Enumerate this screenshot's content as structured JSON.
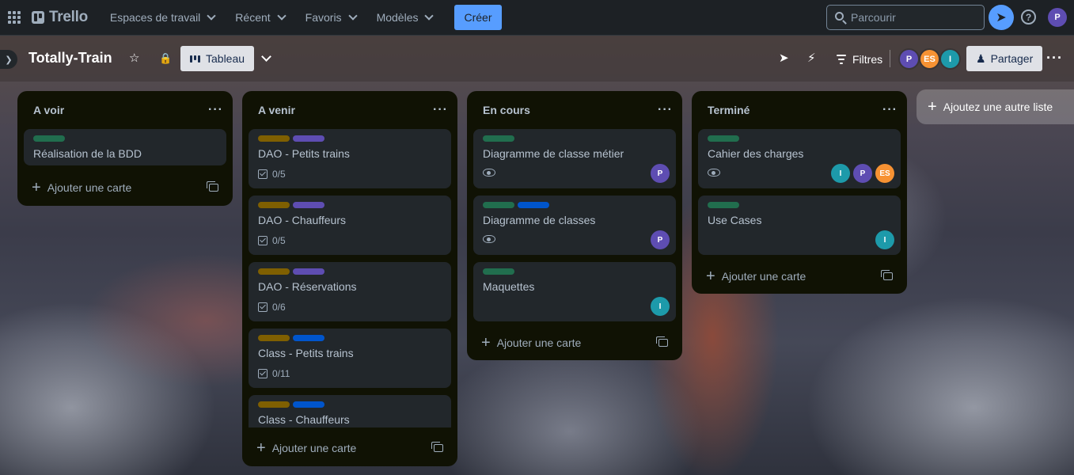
{
  "topnav": {
    "logo": "Trello",
    "menus": [
      "Espaces de travail",
      "Récent",
      "Favoris",
      "Modèles"
    ],
    "create_label": "Créer",
    "search_placeholder": "Parcourir",
    "user_initial": "P"
  },
  "board": {
    "title": "Totally-Train",
    "view_label": "Tableau",
    "filters_label": "Filtres",
    "members": [
      {
        "initials": "P",
        "color": "#5e4db2"
      },
      {
        "initials": "ES",
        "color": "#f79233"
      },
      {
        "initials": "I",
        "color": "#1d9aaa"
      }
    ],
    "share_label": "Partager",
    "add_list_label": "Ajoutez une autre liste"
  },
  "colors": {
    "green": "#216e4e",
    "yellow": "#7f5f01",
    "purple": "#5e4db2",
    "blue": "#0055cc",
    "primary": "#579dff"
  },
  "lists": [
    {
      "title": "A voir",
      "add_card_label": "Ajouter une carte",
      "cards": [
        {
          "title": "Réalisation de la BDD",
          "labels": [
            "green"
          ]
        }
      ]
    },
    {
      "title": "A venir",
      "add_card_label": "Ajouter une carte",
      "cards": [
        {
          "title": "DAO - Petits trains",
          "labels": [
            "yellow",
            "purple"
          ],
          "checklist": "0/5"
        },
        {
          "title": "DAO - Chauffeurs",
          "labels": [
            "yellow",
            "purple"
          ],
          "checklist": "0/5"
        },
        {
          "title": "DAO - Réservations",
          "labels": [
            "yellow",
            "purple"
          ],
          "checklist": "0/6"
        },
        {
          "title": "Class - Petits trains",
          "labels": [
            "yellow",
            "blue"
          ],
          "checklist": "0/11"
        },
        {
          "title": "Class - Chauffeurs",
          "labels": [
            "yellow",
            "blue"
          ]
        }
      ]
    },
    {
      "title": "En cours",
      "add_card_label": "Ajouter une carte",
      "cards": [
        {
          "title": "Diagramme de classe métier",
          "labels": [
            "green"
          ],
          "watched": true,
          "members": [
            "P"
          ]
        },
        {
          "title": "Diagramme de classes",
          "labels": [
            "green",
            "blue"
          ],
          "watched": true,
          "members": [
            "P"
          ]
        },
        {
          "title": "Maquettes",
          "labels": [
            "green"
          ],
          "members": [
            "I"
          ]
        }
      ]
    },
    {
      "title": "Terminé",
      "add_card_label": "Ajouter une carte",
      "cards": [
        {
          "title": "Cahier des charges",
          "labels": [
            "green"
          ],
          "watched": true,
          "members": [
            "I",
            "P",
            "ES"
          ]
        },
        {
          "title": "Use Cases",
          "labels": [
            "green"
          ],
          "members": [
            "I"
          ]
        }
      ]
    }
  ]
}
